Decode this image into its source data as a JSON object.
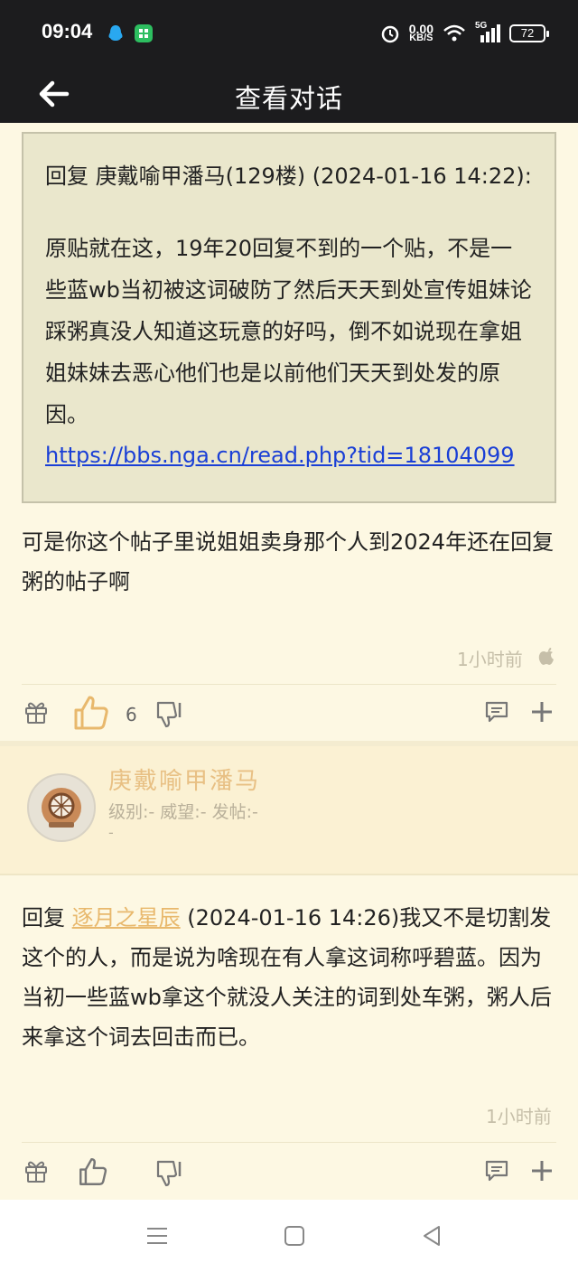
{
  "status": {
    "time": "09:04",
    "netspeed_value": "0.00",
    "netspeed_unit": "KB/S",
    "network": "5G",
    "battery": "72"
  },
  "header": {
    "title": "查看对话"
  },
  "quote": {
    "header": "回复 庚戴喻甲潘马(129楼) (2024-01-16 14:22):",
    "body": "原贴就在这，19年20回复不到的一个贴，不是一些蓝wb当初被这词破防了然后天天到处宣传姐妹论踩粥真没人知道这玩意的好吗，倒不如说现在拿姐姐妹妹去恶心他们也是以前他们天天到处发的原因。",
    "link": "https://bbs.nga.cn/read.php?tid=18104099"
  },
  "post1": {
    "text": "可是你这个帖子里说姐姐卖身那个人到2024年还在回复粥的帖子啊",
    "time": "1小时前",
    "like_count": "6"
  },
  "user2": {
    "name": "庚戴喻甲潘马",
    "meta": "级别:-  威望:-  发帖:-",
    "meta2": "-"
  },
  "post2": {
    "reply_prefix": "回复 ",
    "reply_user": "逐月之星辰",
    "text": " (2024-01-16 14:26)我又不是切割发这个的人，而是说为啥现在有人拿这词称呼碧蓝。因为当初一些蓝wb拿这个就没人关注的词到处车粥，粥人后来拿这个词去回击而已。",
    "time": "1小时前"
  },
  "colors": {
    "background": "#fdf8e3",
    "header": "#1c1c1e",
    "accent_like": "#e8b86c",
    "link": "#1a3fd6"
  }
}
